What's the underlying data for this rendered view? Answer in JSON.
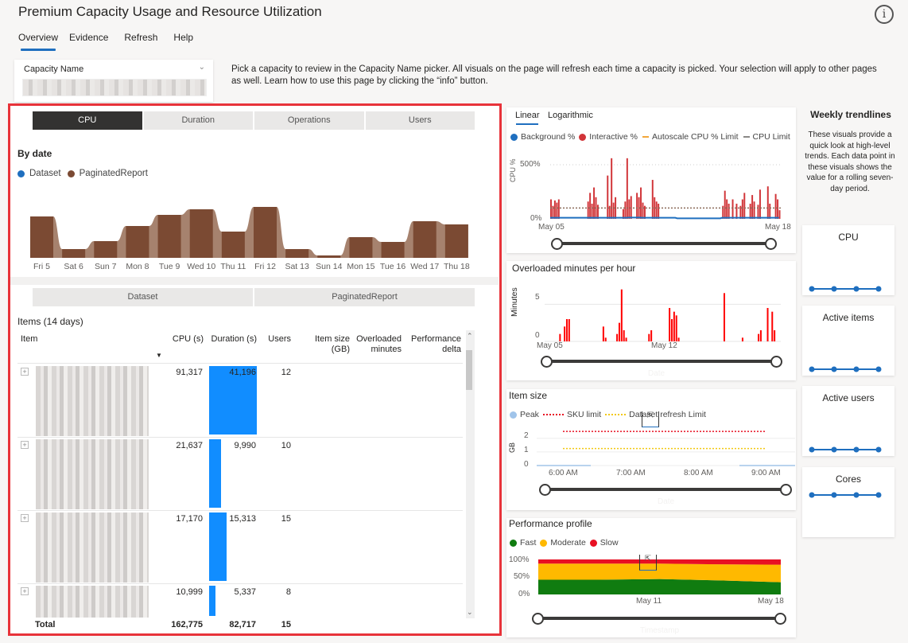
{
  "header": {
    "title": "Premium Capacity Usage and Resource Utilization",
    "info_icon": "info-icon",
    "nav": [
      "Overview",
      "Evidence",
      "Refresh",
      "Help"
    ],
    "active_nav": "Overview"
  },
  "picker": {
    "label": "Capacity Name",
    "value": "(redacted)",
    "chevron_icon": "chevron-down-icon"
  },
  "description": "Pick a capacity to review in the Capacity Name picker. All visuals on the page will refresh each time a capacity is picked. Your selection will apply to other pages as well. Learn how to use this page by clicking the “info” button.",
  "metric_tabs": [
    "CPU",
    "Duration",
    "Operations",
    "Users"
  ],
  "active_metric_tab": "CPU",
  "by_date": {
    "title": "By date",
    "legend": [
      {
        "label": "Dataset",
        "color": "#1f6fbf"
      },
      {
        "label": "PaginatedReport",
        "color": "#7b4a33"
      }
    ]
  },
  "item_type_tabs": [
    "Dataset",
    "PaginatedReport"
  ],
  "items_table": {
    "title": "Items (14 days)",
    "columns": [
      "Item",
      "CPU (s)",
      "Duration (s)",
      "Users",
      "Item size (GB)",
      "Overloaded minutes",
      "Performance delta"
    ],
    "rows": [
      {
        "item": "(redacted)",
        "cpu": "91,317",
        "duration": "41,196",
        "duration_value": 41196,
        "users": "12"
      },
      {
        "item": "(redacted)",
        "cpu": "21,637",
        "duration": "9,990",
        "duration_value": 9990,
        "users": "10"
      },
      {
        "item": "(redacted)",
        "cpu": "17,170",
        "duration": "15,313",
        "duration_value": 15313,
        "users": "15"
      },
      {
        "item": "(redacted)",
        "cpu": "10,999",
        "duration": "5,337",
        "duration_value": 5337,
        "users": "8"
      }
    ],
    "total": {
      "label": "Total",
      "cpu": "162,775",
      "duration": "82,717",
      "users": "15"
    }
  },
  "cpu_chart": {
    "scale_tabs": [
      "Linear",
      "Logarithmic"
    ],
    "active_scale": "Linear",
    "legend": [
      {
        "label": "Background %",
        "color": "#1f6fbf",
        "type": "dot"
      },
      {
        "label": "Interactive %",
        "color": "#d13438",
        "type": "dot"
      },
      {
        "label": "Autoscale CPU % Limit",
        "color": "#f2a73b",
        "type": "line"
      },
      {
        "label": "CPU Limit",
        "color": "#8a8886",
        "type": "line"
      }
    ],
    "ylabel": "CPU %",
    "yticks": [
      "500%",
      "0%"
    ],
    "xticks": [
      "May 05",
      "May 18"
    ]
  },
  "overloaded_chart": {
    "title": "Overloaded minutes per hour",
    "ylabel": "Minutes",
    "yticks": [
      "5",
      "0"
    ],
    "xticks": [
      "May 05",
      "May 12"
    ],
    "xlabel": "Date"
  },
  "item_size_chart": {
    "title": "Item size",
    "legend": [
      {
        "label": "Peak",
        "color": "#a0c4ea",
        "type": "dot"
      },
      {
        "label": "SKU limit",
        "color": "#e81123",
        "type": "dotted"
      },
      {
        "label": "Dataset refresh Limit",
        "color": "#f2c811",
        "type": "dotted"
      }
    ],
    "ylabel": "GB",
    "yticks": [
      "2",
      "1",
      "0"
    ],
    "xticks": [
      "6:00 AM",
      "7:00 AM",
      "8:00 AM",
      "9:00 AM"
    ],
    "xlabel": "Date"
  },
  "perf_chart": {
    "title": "Performance profile",
    "legend": [
      {
        "label": "Fast",
        "color": "#107c10"
      },
      {
        "label": "Moderate",
        "color": "#ffb900"
      },
      {
        "label": "Slow",
        "color": "#e81123"
      }
    ],
    "yticks": [
      "100%",
      "50%",
      "0%"
    ],
    "xticks": [
      "May 11",
      "May 18"
    ],
    "xlabel": "Timestamp"
  },
  "trendlines": {
    "title": "Weekly trendlines",
    "description": "These visuals provide a quick look at high-level trends. Each data point in these visuals shows the value for a rolling seven-day period.",
    "cards": [
      {
        "title": "CPU",
        "points": [
          0.05,
          0.05,
          0.05,
          0.05
        ]
      },
      {
        "title": "Active items",
        "points": [
          0.05,
          0.05,
          0.05,
          0.05
        ]
      },
      {
        "title": "Active users",
        "points": [
          0.05,
          0.05,
          0.05,
          0.05
        ]
      },
      {
        "title": "Cores",
        "points": [
          0.8,
          0.8,
          0.8,
          0.8
        ]
      }
    ]
  },
  "chart_data": [
    {
      "type": "area",
      "title": "By date",
      "categories": [
        "Fri 5",
        "Sat 6",
        "Sun 7",
        "Mon 8",
        "Tue 9",
        "Wed 10",
        "Thu 11",
        "Fri 12",
        "Sat 13",
        "Sun 14",
        "Mon 15",
        "Tue 16",
        "Wed 17",
        "Thu 18"
      ],
      "series": [
        {
          "name": "PaginatedReport",
          "values": [
            52,
            11,
            21,
            40,
            54,
            61,
            33,
            64,
            11,
            3,
            26,
            20,
            46,
            42
          ]
        }
      ],
      "ylabel": "",
      "xlabel": ""
    },
    {
      "type": "bar",
      "title": "CPU %",
      "x_range": [
        "May 05",
        "May 18"
      ],
      "ylim": [
        0,
        600
      ],
      "series": [
        {
          "name": "Interactive %",
          "values": [
            180,
            120,
            170,
            150,
            180,
            0,
            0,
            0,
            0,
            0,
            0,
            0,
            0,
            0,
            0,
            0,
            0,
            0,
            0,
            160,
            240,
            140,
            290,
            200,
            130,
            0,
            0,
            0,
            0,
            400,
            120,
            560,
            150,
            200,
            0,
            0,
            0,
            90,
            160,
            560,
            180,
            210,
            0,
            0,
            240,
            200,
            290,
            150,
            120,
            0,
            0,
            0,
            360,
            200,
            160,
            140,
            0,
            0,
            0,
            0,
            0,
            0,
            0,
            0,
            0,
            0,
            0,
            0,
            0,
            0,
            0,
            0,
            0,
            0,
            0,
            0,
            0,
            0,
            0,
            0,
            0,
            0,
            0,
            0,
            0,
            0,
            0,
            0,
            120,
            260,
            180,
            140,
            0,
            180,
            0,
            140,
            0,
            120,
            180,
            240,
            0,
            0,
            140,
            220,
            160,
            0,
            130,
            270,
            0,
            0,
            0,
            300,
            140,
            0,
            0,
            230,
            180,
            80
          ]
        },
        {
          "name": "Background %",
          "values": [
            10,
            10,
            10,
            10,
            10,
            10,
            10,
            10,
            10,
            10,
            10,
            10,
            10,
            10,
            10,
            10,
            10,
            10,
            10,
            10,
            10,
            10,
            10,
            10,
            10,
            10,
            10,
            10,
            10,
            10,
            10,
            10,
            10,
            10,
            10,
            10,
            10,
            10,
            10,
            10,
            12,
            12,
            12,
            12,
            12,
            12,
            12,
            10,
            10,
            10,
            10,
            10,
            10,
            10,
            10,
            10,
            10,
            10,
            10,
            10,
            10,
            10,
            10,
            10,
            10,
            5,
            5,
            5,
            5,
            5,
            5,
            5,
            5,
            5,
            5,
            5,
            5,
            5,
            5,
            5,
            5,
            5,
            5,
            5,
            5,
            5,
            5,
            5,
            10,
            10,
            10,
            10,
            10,
            10,
            10,
            10,
            10,
            10,
            10,
            10,
            10,
            10,
            10,
            10,
            10,
            10,
            10,
            10,
            10,
            10,
            10,
            10,
            10,
            10,
            10,
            10,
            10,
            10
          ]
        },
        {
          "name": "CPU Limit",
          "values": [
            100
          ]
        }
      ]
    },
    {
      "type": "bar",
      "title": "Overloaded minutes per hour",
      "ylim": [
        0,
        7.5
      ],
      "x_range": [
        "May 05",
        "May 19"
      ],
      "series": [
        {
          "name": "Minutes",
          "points": [
            [
              0.05,
              1
            ],
            [
              0.07,
              2
            ],
            [
              0.08,
              3
            ],
            [
              0.09,
              3
            ],
            [
              0.24,
              2
            ],
            [
              0.25,
              0.5
            ],
            [
              0.3,
              1
            ],
            [
              0.31,
              2.5
            ],
            [
              0.32,
              7
            ],
            [
              0.33,
              1.5
            ],
            [
              0.34,
              0.5
            ],
            [
              0.44,
              1
            ],
            [
              0.45,
              1.5
            ],
            [
              0.53,
              4.5
            ],
            [
              0.54,
              3
            ],
            [
              0.55,
              4
            ],
            [
              0.56,
              3.5
            ],
            [
              0.57,
              0.5
            ],
            [
              0.77,
              6.5
            ],
            [
              0.85,
              0.5
            ],
            [
              0.92,
              1
            ],
            [
              0.93,
              1.5
            ],
            [
              0.96,
              4.5
            ],
            [
              0.98,
              4
            ],
            [
              0.99,
              1.5
            ]
          ]
        }
      ]
    },
    {
      "type": "line",
      "title": "Item size",
      "ylim": [
        0,
        2.8
      ],
      "series": [
        {
          "name": "SKU limit",
          "values": [
            2.5
          ]
        },
        {
          "name": "Dataset refresh Limit",
          "values": [
            1.25
          ]
        },
        {
          "name": "Peak",
          "values": [
            0.02
          ]
        }
      ]
    },
    {
      "type": "area",
      "title": "Performance profile",
      "ylim": [
        0,
        100
      ],
      "x": [
        0,
        0.25,
        0.5,
        0.75,
        1
      ],
      "series": [
        {
          "name": "Fast",
          "values": [
            42,
            42,
            44,
            40,
            35
          ]
        },
        {
          "name": "Moderate",
          "values": [
            46,
            46,
            44,
            46,
            50
          ]
        },
        {
          "name": "Slow",
          "values": [
            12,
            12,
            12,
            14,
            15
          ]
        }
      ]
    }
  ]
}
